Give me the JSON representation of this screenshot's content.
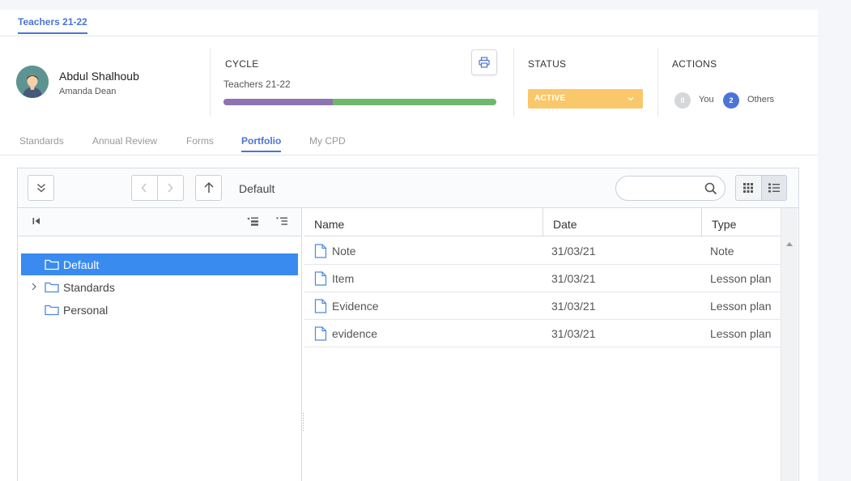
{
  "top_tab": {
    "label": "Teachers 21-22"
  },
  "user": {
    "name": "Abdul Shalhoub",
    "subtitle": "Amanda Dean"
  },
  "cycle": {
    "label": "CYCLE",
    "name": "Teachers 21-22",
    "progress_fraction": 0.4,
    "colors": {
      "done": "#8e73b2",
      "remaining": "#6fb66e"
    }
  },
  "status": {
    "label": "STATUS",
    "value": "ACTIVE",
    "color": "#f9c86a"
  },
  "actions": {
    "label": "ACTIONS",
    "you_count": "0",
    "you_label": "You",
    "others_count": "2",
    "others_label": "Others"
  },
  "subtabs": [
    {
      "label": "Standards",
      "active": false
    },
    {
      "label": "Annual Review",
      "active": false
    },
    {
      "label": "Forms",
      "active": false
    },
    {
      "label": "Portfolio",
      "active": true
    },
    {
      "label": "My CPD",
      "active": false
    }
  ],
  "file_manager": {
    "current_path": "Default",
    "search": {
      "value": "",
      "placeholder": ""
    },
    "tree": [
      {
        "label": "Default",
        "selected": true,
        "expandable": false
      },
      {
        "label": "Standards",
        "selected": false,
        "expandable": true
      },
      {
        "label": "Personal",
        "selected": false,
        "expandable": false
      }
    ],
    "columns": [
      "Name",
      "Date",
      "Type"
    ],
    "rows": [
      {
        "name": "Note",
        "date": "31/03/21",
        "type": "Note"
      },
      {
        "name": "Item",
        "date": "31/03/21",
        "type": "Lesson plan"
      },
      {
        "name": "Evidence",
        "date": "31/03/21",
        "type": "Lesson plan"
      },
      {
        "name": "evidence",
        "date": "31/03/21",
        "type": "Lesson plan"
      }
    ]
  },
  "accent_color": "#4a74d6"
}
